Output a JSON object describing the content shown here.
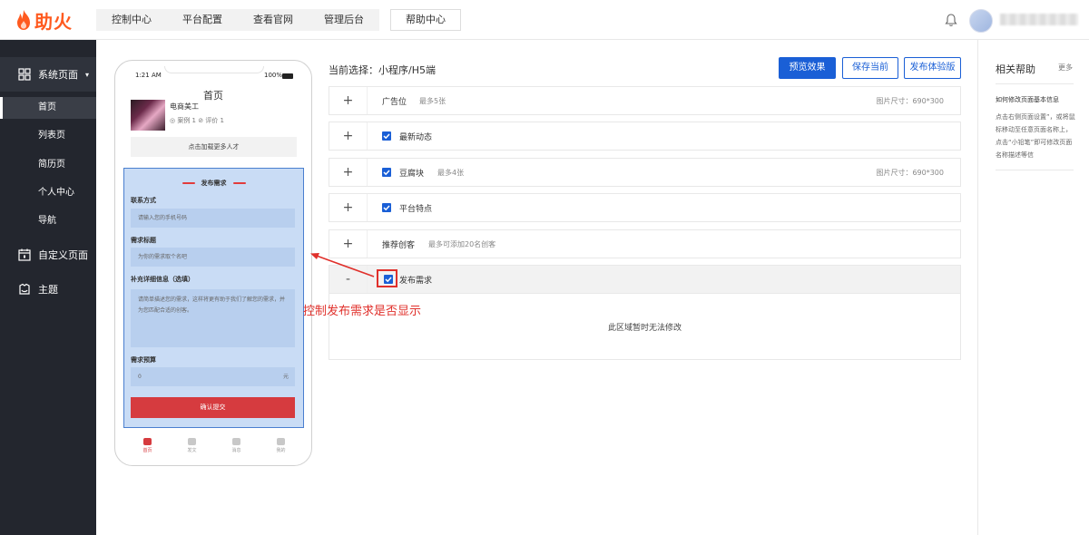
{
  "brand": {
    "name": "助火",
    "color": "#ff5a1f"
  },
  "topnav": {
    "items": [
      "控制中心",
      "平台配置",
      "查看官网",
      "管理后台"
    ],
    "help": "帮助中心"
  },
  "sidebar": {
    "groups": [
      {
        "label": "系统页面",
        "icon": "layout-icon"
      },
      {
        "label": "自定义页面",
        "icon": "calendar-icon"
      },
      {
        "label": "主题",
        "icon": "theme-icon"
      }
    ],
    "items": [
      "首页",
      "列表页",
      "简历页",
      "个人中心",
      "导航"
    ],
    "active_item": "首页"
  },
  "phone": {
    "time": "1:21 AM",
    "battery": "100%",
    "title": "首页",
    "profile_name": "电商美工",
    "profile_meta": "◎ 案例 1   ⊘ 评价 1",
    "load_more": "点击加载更多人才",
    "form": {
      "heading": "发布需求",
      "contact_label": "联系方式",
      "contact_placeholder": "请输入您的手机号码",
      "title_label": "需求标题",
      "title_placeholder": "为你的需求取个名吧",
      "detail_label": "补充详细信息（选填）",
      "detail_placeholder": "请简单描述您的需求，这样将更有助于我们了解您的需求，并为您匹配合适的创客。",
      "budget_label": "需求预算",
      "budget_value": "0",
      "budget_unit": "元",
      "submit": "确认提交"
    },
    "tabs": [
      "首页",
      "发文",
      "消息",
      "我的"
    ]
  },
  "main": {
    "current_select": "当前选择：小程序/H5端",
    "buttons": {
      "preview": "预览效果",
      "save": "保存当前",
      "publish": "发布体验版"
    },
    "modules": [
      {
        "toggle": "+",
        "checked": false,
        "name": "广告位",
        "hint": "最多5张",
        "size": "图片尺寸：690*300"
      },
      {
        "toggle": "+",
        "checked": true,
        "name": "最新动态",
        "hint": "",
        "size": ""
      },
      {
        "toggle": "+",
        "checked": true,
        "name": "豆腐块",
        "hint": "最多4张",
        "size": "图片尺寸：690*300"
      },
      {
        "toggle": "+",
        "checked": true,
        "name": "平台特点",
        "hint": "",
        "size": ""
      },
      {
        "toggle": "+",
        "checked": false,
        "name": "推荐创客",
        "hint": "最多可添加20名创客",
        "size": ""
      },
      {
        "toggle": "-",
        "checked": true,
        "name": "发布需求",
        "hint": "",
        "size": ""
      }
    ],
    "expanded_message": "此区域暂时无法修改",
    "annotation": "控制发布需求是否显示"
  },
  "right_panel": {
    "title": "相关帮助",
    "more": "更多",
    "subtitle": "如何修改页面基本信息",
    "description": "点击右侧页面设置”，或将鼠标移动至任意页面名称上，点击“小铅笔”即可修改页面名称描述等信"
  },
  "colors": {
    "primary": "#1a5fd6",
    "accent_red": "#e0302b",
    "sidebar_bg": "#23262e"
  }
}
